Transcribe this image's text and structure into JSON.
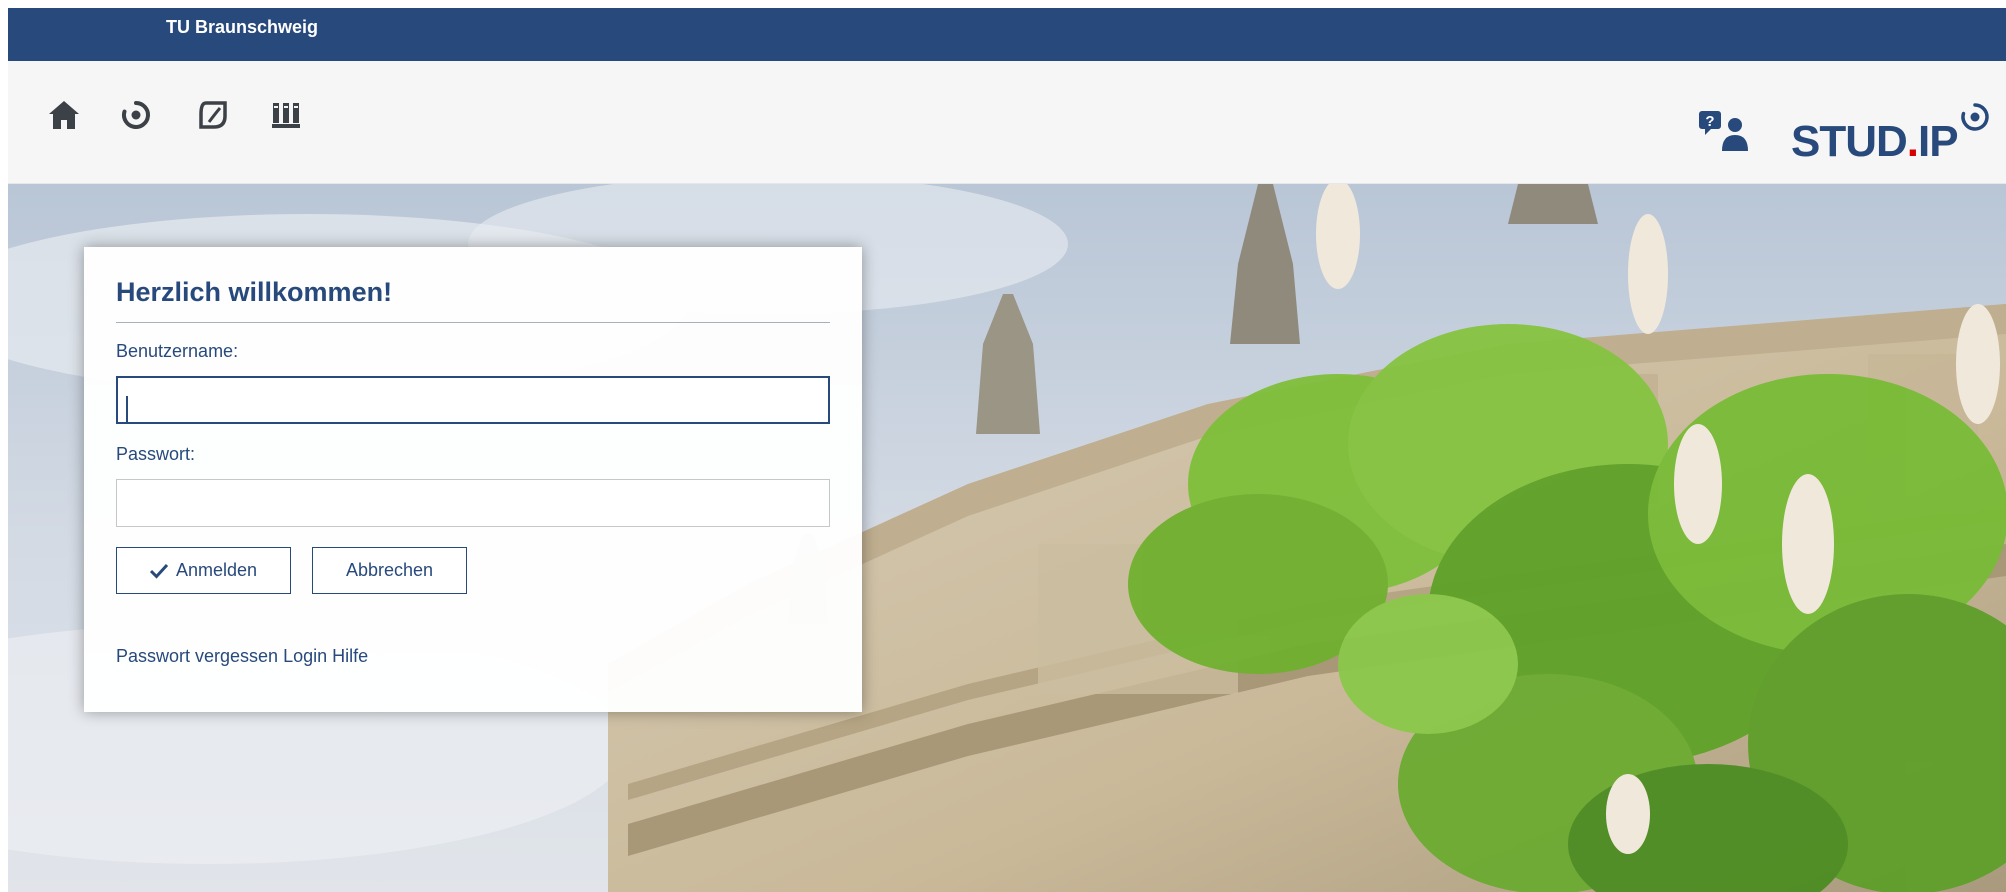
{
  "header": {
    "institution": "TU Braunschweig"
  },
  "nav": {
    "icons": [
      "home-icon",
      "profile-icon",
      "courses-icon",
      "library-icon"
    ],
    "help_icon": "help-icon",
    "logo": {
      "prefix": "STUD",
      "dot": ".",
      "suffix": "IP"
    }
  },
  "login": {
    "title": "Herzlich willkommen!",
    "username_label": "Benutzername:",
    "username_value": "",
    "password_label": "Passwort:",
    "password_value": "",
    "login_button": "Anmelden",
    "cancel_button": "Abbrechen",
    "forgot_password_link": "Passwort vergessen",
    "help_link": "Login Hilfe"
  },
  "colors": {
    "brand": "#28497c",
    "logo_dot": "#d60000",
    "nav_bg": "#f6f6f6"
  }
}
